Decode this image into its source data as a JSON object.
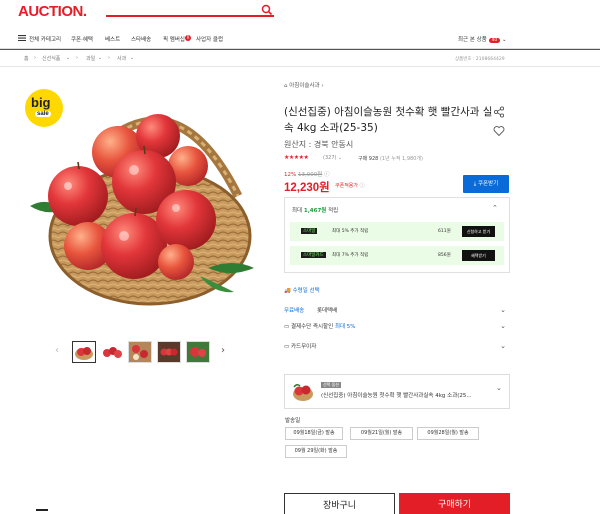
{
  "header": {
    "logo": "AUCTION."
  },
  "gnb": {
    "category": "전체 카테고리",
    "items": [
      "쿠폰·혜택",
      "베스트",
      "스타배송",
      "픽 멤버십",
      "사업자 클럽"
    ],
    "membership_badge": "R",
    "recent": "최근 본 상품",
    "recent_count": "40"
  },
  "breadcrumb": [
    "홈",
    "신선식품",
    "과일",
    "사과"
  ],
  "product_no": "상품번호 : 2108664429",
  "gallery": {
    "badge_line1": "big",
    "badge_line2": "sale",
    "thumbnails": 5
  },
  "product": {
    "shop": "아침이슬사과",
    "title": "(신선집중) 아침이슬농원 첫수확 햇 빨간사과 실속 4kg 소과(25-35)",
    "origin": "원산지 : 경북 안동시",
    "rating_stars": 4.5,
    "review_count": "(327)",
    "buy_count": "구매 928",
    "buy_count_sub": "(1년 누적 1,980개)",
    "discount_pct": "12%",
    "original_price": "13,900원",
    "price": "12,230원",
    "coupon_note": "쿠폰적용가",
    "coupon_button": "쿠폰받기"
  },
  "points": {
    "title_prefix": "최대",
    "title_amount": "1,467원",
    "title_suffix": "적립",
    "rows": [
      {
        "tag": "스마일",
        "text": "최대 5% 추가 적립",
        "amount": "611원",
        "button": "신청하고 받기"
      },
      {
        "tag": "스마일카드",
        "text": "최대 7% 추가 적립",
        "amount": "856원",
        "button": "혜택받기"
      }
    ]
  },
  "options": {
    "link": "수령일 선택",
    "shipping_free": "무료배송",
    "shipping_carrier": "롯데택배",
    "discount_label": "결제수단 즉시할인",
    "discount_value": "최대 5%",
    "card_label": "카드무이자"
  },
  "selected": {
    "badge": "선택 옵션",
    "text": "(신선집중) 아침이슬농원 첫수확 햇 빨간사과실속 4kg 소과(25..."
  },
  "delivery": {
    "label": "발송일",
    "dates": [
      "09월18일(금) 발송",
      "09월21일(월) 발송",
      "09월28일(월) 발송",
      "09월 29일(화) 발송"
    ]
  },
  "actions": {
    "cart": "장바구니",
    "buy": "구매하기"
  },
  "colors": {
    "brand_red": "#e31e26",
    "link_blue": "#0a6bd8",
    "point_green": "#1e9b3b"
  }
}
